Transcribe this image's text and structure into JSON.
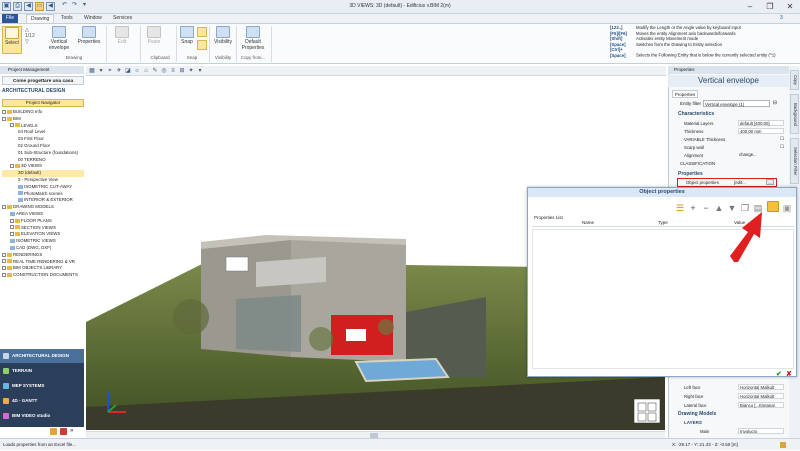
{
  "window": {
    "title": "3D VIEWS: 3D (default) - Edificius v.BIM 2(m)",
    "controls": [
      "–",
      "❐",
      "✕"
    ]
  },
  "quick_access": [
    "▣",
    "⎙",
    "◀",
    "↶",
    "↷",
    "▾"
  ],
  "ribbon_tabs": [
    "File",
    "Drawing",
    "Tools",
    "Window",
    "Services"
  ],
  "tab_counter": "3",
  "ribbon": {
    "select": "Select",
    "counter": "1/12",
    "vertical_envelope": "Vertical envelope",
    "properties": "Properties",
    "edit": "Edit",
    "paste": "Paste",
    "snap": "Snap",
    "visibility": "Visibility",
    "default_properties": "Default Properties",
    "groups": {
      "drawing": "Drawing",
      "clipboard": "Clipboard",
      "snap": "Snap",
      "visibility": "Visibility",
      "copy_from": "Copy from..."
    }
  },
  "help_lines": [
    {
      "keys": "[123..]",
      "text": "Modify the Length or the Angle value by keyboard input"
    },
    {
      "keys": "[F5]/[F6]",
      "text": "Moves the entity Alignment axis backwards/forwards"
    },
    {
      "keys": "[Shift]",
      "text": "Activates entity Movement mode"
    },
    {
      "keys": "[Space]",
      "text": "Switches from the Drawing to Entity selection"
    },
    {
      "keys": "[Ctrl]+[Space]",
      "text": "Selects the Following Entity that is below the currently selected entity (^1)"
    }
  ],
  "left_panel": {
    "header": "Project Management",
    "project_name": "Come progettare una casa",
    "section_title": "ARCHITECTURAL DESIGN",
    "navigator": "Project Navigator",
    "tree": [
      {
        "label": "BUILDING Info",
        "indent": 0,
        "icon": "folder"
      },
      {
        "label": "BIM",
        "indent": 0,
        "icon": "folder"
      },
      {
        "label": "LEVELS",
        "indent": 1,
        "icon": "folder"
      },
      {
        "label": "04 Roof Level",
        "indent": 2,
        "icon": "none"
      },
      {
        "label": "03 First Floor",
        "indent": 2,
        "icon": "none"
      },
      {
        "label": "02 Ground Floor",
        "indent": 2,
        "icon": "none"
      },
      {
        "label": "01 Sub-Structure (foundations)",
        "indent": 2,
        "icon": "none"
      },
      {
        "label": "00 TERRENO",
        "indent": 2,
        "icon": "none"
      },
      {
        "label": "3D VIEWS",
        "indent": 1,
        "icon": "folder"
      },
      {
        "label": "3D (default)",
        "indent": 2,
        "icon": "none",
        "selected": true
      },
      {
        "label": "3 - Perspective View",
        "indent": 2,
        "icon": "none"
      },
      {
        "label": "ISOMETRIC CUT-AWAY",
        "indent": 2,
        "icon": "box"
      },
      {
        "label": "PhotoMatch scenes",
        "indent": 2,
        "icon": "box"
      },
      {
        "label": "INTERIOR & EXTERIOR",
        "indent": 2,
        "icon": "box"
      },
      {
        "label": "DRAWING MODELS",
        "indent": 0,
        "icon": "folder"
      },
      {
        "label": "AREA VIEWS",
        "indent": 1,
        "icon": "box"
      },
      {
        "label": "FLOOR PLANS",
        "indent": 1,
        "icon": "folder"
      },
      {
        "label": "SECTION VIEWS",
        "indent": 1,
        "icon": "folder"
      },
      {
        "label": "ELEVATION VIEWS",
        "indent": 1,
        "icon": "folder"
      },
      {
        "label": "ISOMETRIC VIEWS",
        "indent": 1,
        "icon": "box"
      },
      {
        "label": "CAD (DWG, DXF)",
        "indent": 1,
        "icon": "box"
      },
      {
        "label": "RENDERINGS",
        "indent": 0,
        "icon": "folder"
      },
      {
        "label": "REAL TIME RENDERING & VR",
        "indent": 0,
        "icon": "folder"
      },
      {
        "label": "BIM OBJECTS LIBRARY",
        "indent": 0,
        "icon": "folder"
      },
      {
        "label": "CONSTRUCTION DOCUMENTS",
        "indent": 0,
        "icon": "folder"
      }
    ],
    "bottom_nav": [
      "ARCHITECTURAL DESIGN",
      "TERRAIN",
      "MEP SYSTEMS",
      "4D - GANTT",
      "BIM VIDEO studio"
    ]
  },
  "properties_panel": {
    "header": "Properties",
    "title": "Vertical envelope",
    "tab": "Properties",
    "entity_filter_label": "Entity filter",
    "entity_filter_value": "Vertical envelope (1)",
    "characteristics": "Characteristics",
    "rows": [
      {
        "label": "Material Layers",
        "value": "default [400.00]"
      },
      {
        "label": "Thickness",
        "value": "400.00 mm"
      },
      {
        "label": "VARIABLE Thickness",
        "value": "☐"
      },
      {
        "label": "Scarp wall",
        "value": "☐"
      },
      {
        "label": "Alignment",
        "value": "change..."
      },
      {
        "label": "CLASSIFICATION",
        "value": ""
      }
    ],
    "properties_section": "Properties",
    "object_properties_label": "Object properties",
    "object_properties_value": "[edit...",
    "lower_rows": [
      {
        "label": "Left face",
        "value": "Horizontal Malkult"
      },
      {
        "label": "Right face",
        "value": "Horizontal Malkult"
      },
      {
        "label": "Lateral face",
        "value": "Bianco [...Eintanal"
      }
    ],
    "drawing_models": "Drawing Models",
    "layers": "LAYERS",
    "main_label": "Main",
    "main_value": "Involucro"
  },
  "vertical_tabs": [
    "Copy",
    "Background",
    "Selection Filter"
  ],
  "object_properties_dialog": {
    "title": "Object properties",
    "list_label": "Properties List",
    "columns": [
      "Name",
      "Type",
      "Value"
    ]
  },
  "statusbar": {
    "left": "Loads properties from an Excel file...",
    "right": "X: -29.17 - Y: 21.43 - Z: -0.50 [m]"
  },
  "colors": {
    "accent": "#2b579a",
    "red_wall": "#d11f1f",
    "arrow": "#e02020"
  }
}
